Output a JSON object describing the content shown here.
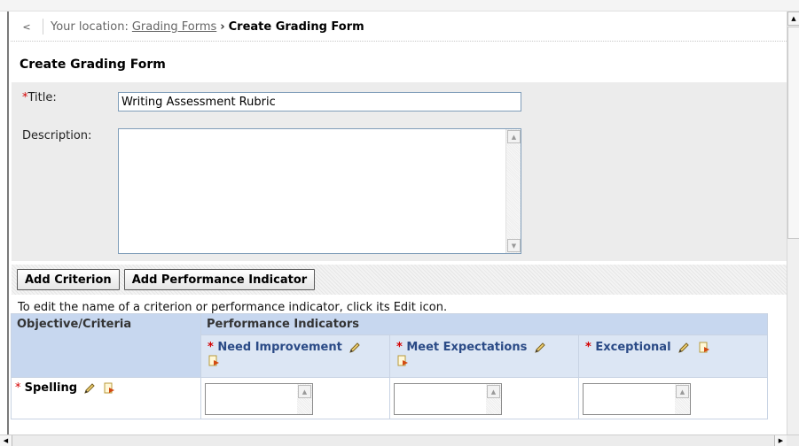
{
  "breadcrumb": {
    "back_label": "<",
    "location_prefix": "Your location:",
    "parent_link": "Grading Forms",
    "arrow": "›",
    "current": "Create Grading Form"
  },
  "page": {
    "title": "Create Grading Form"
  },
  "form": {
    "required_marker": "*",
    "title_label": "Title:",
    "title_value": "Writing Assessment Rubric",
    "description_label": "Description:",
    "description_value": ""
  },
  "toolbar": {
    "add_criterion": "Add Criterion",
    "add_indicator": "Add Performance Indicator"
  },
  "hint": "To edit the name of a criterion or performance indicator, click its Edit icon.",
  "rubric": {
    "col_criteria": "Objective/Criteria",
    "col_indicators": "Performance Indicators",
    "indicators": [
      {
        "name": "Need Improvement"
      },
      {
        "name": "Meet Expectations"
      },
      {
        "name": "Exceptional"
      }
    ],
    "criteria": [
      {
        "name": "Spelling"
      }
    ]
  },
  "icons": {
    "edit": "pencil-icon",
    "delete": "delete-page-icon"
  },
  "colors": {
    "required": "#d40000",
    "table_header": "#c7d7ef",
    "indicator_text": "#2a4a86"
  }
}
